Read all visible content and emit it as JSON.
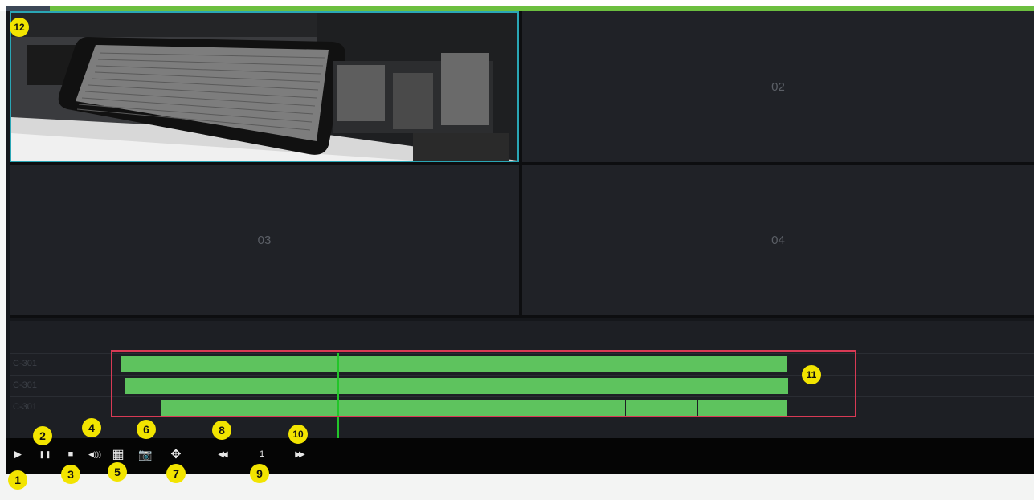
{
  "panes": [
    {
      "label": "",
      "active": true
    },
    {
      "label": "02",
      "active": false
    },
    {
      "label": "03",
      "active": false
    },
    {
      "label": "04",
      "active": false
    }
  ],
  "tracks": [
    {
      "label": "C-301"
    },
    {
      "label": "C-301"
    },
    {
      "label": "C-301"
    }
  ],
  "controls": {
    "play": "▶",
    "pause": "❚❚",
    "stop": "■",
    "volume": "◀)))",
    "clip": "▦",
    "snapshot": "📷",
    "zoom": "✥",
    "slow": "◀◀",
    "speed": "1",
    "fast": "▶▶"
  },
  "badges": [
    "1",
    "2",
    "3",
    "4",
    "5",
    "6",
    "7",
    "8",
    "9",
    "10",
    "11",
    "12"
  ],
  "colors": {
    "accent": "#6cbf3f",
    "record": "#5ec35e",
    "cursor": "#22c52a",
    "selection": "#d83a55",
    "badge": "#f2e400"
  }
}
